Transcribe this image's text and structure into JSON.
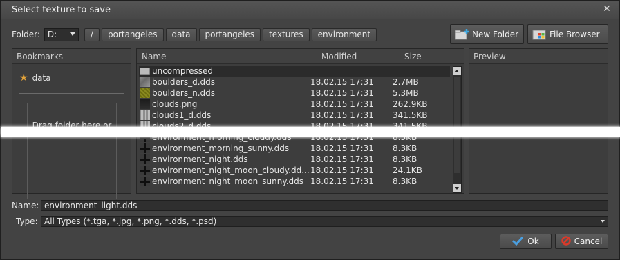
{
  "window": {
    "title": "Select texture to save"
  },
  "toolbar": {
    "folder_label": "Folder:",
    "drive": "D:",
    "breadcrumbs": [
      "/",
      "portangeles",
      "data",
      "portangeles",
      "textures",
      "environment"
    ],
    "new_folder_label": "New Folder",
    "file_browser_label": "File Browser"
  },
  "bookmarks": {
    "header": "Bookmarks",
    "items": [
      {
        "label": "data",
        "icon": "star-icon"
      }
    ],
    "dropzone_text": "Drag folder here or"
  },
  "files": {
    "headers": {
      "name": "Name",
      "modified": "Modified",
      "size": "Size"
    },
    "rows": [
      {
        "name": "uncompressed",
        "modified": "",
        "size": "",
        "kind": "folder"
      },
      {
        "name": "boulders_d.dds",
        "modified": "18.02.15 17:31",
        "size": "2.7MB",
        "kind": "gray"
      },
      {
        "name": "boulders_n.dds",
        "modified": "18.02.15 17:31",
        "size": "5.3MB",
        "kind": "olive"
      },
      {
        "name": "clouds.png",
        "modified": "18.02.15 17:31",
        "size": "262.9KB",
        "kind": "dark"
      },
      {
        "name": "clouds1_d.dds",
        "modified": "18.02.15 17:31",
        "size": "341.5KB",
        "kind": "noise"
      },
      {
        "name": "clouds2_d.dds",
        "modified": "18.02.15 17:31",
        "size": "341.5KB",
        "kind": "noise"
      },
      {
        "name": "environment_morning_cloudy.dds",
        "modified": "18.02.15 17:31",
        "size": "8.3KB",
        "kind": "cross"
      },
      {
        "name": "environment_morning_sunny.dds",
        "modified": "18.02.15 17:31",
        "size": "8.3KB",
        "kind": "cross"
      },
      {
        "name": "environment_night.dds",
        "modified": "18.02.15 17:31",
        "size": "8.3KB",
        "kind": "cross"
      },
      {
        "name": "environment_night_moon_cloudy.dd...",
        "modified": "18.02.15 17:31",
        "size": "24.1KB",
        "kind": "cross"
      },
      {
        "name": "environment_night_moon_sunny.dds",
        "modified": "18.02.15 17:31",
        "size": "8.3KB",
        "kind": "cross"
      }
    ]
  },
  "preview": {
    "header": "Preview"
  },
  "form": {
    "name_label": "Name:",
    "name_value": "environment_light.dds",
    "type_label": "Type:",
    "type_value": "All Types (*.tga, *.jpg, *.png, *.dds, *.psd)"
  },
  "actions": {
    "ok_label": "Ok",
    "cancel_label": "Cancel"
  },
  "colors": {
    "accent_star": "#e3a33a",
    "ok_check": "#4a9fe0",
    "cancel_red": "#d93a2a",
    "window_bg": "#434343"
  }
}
